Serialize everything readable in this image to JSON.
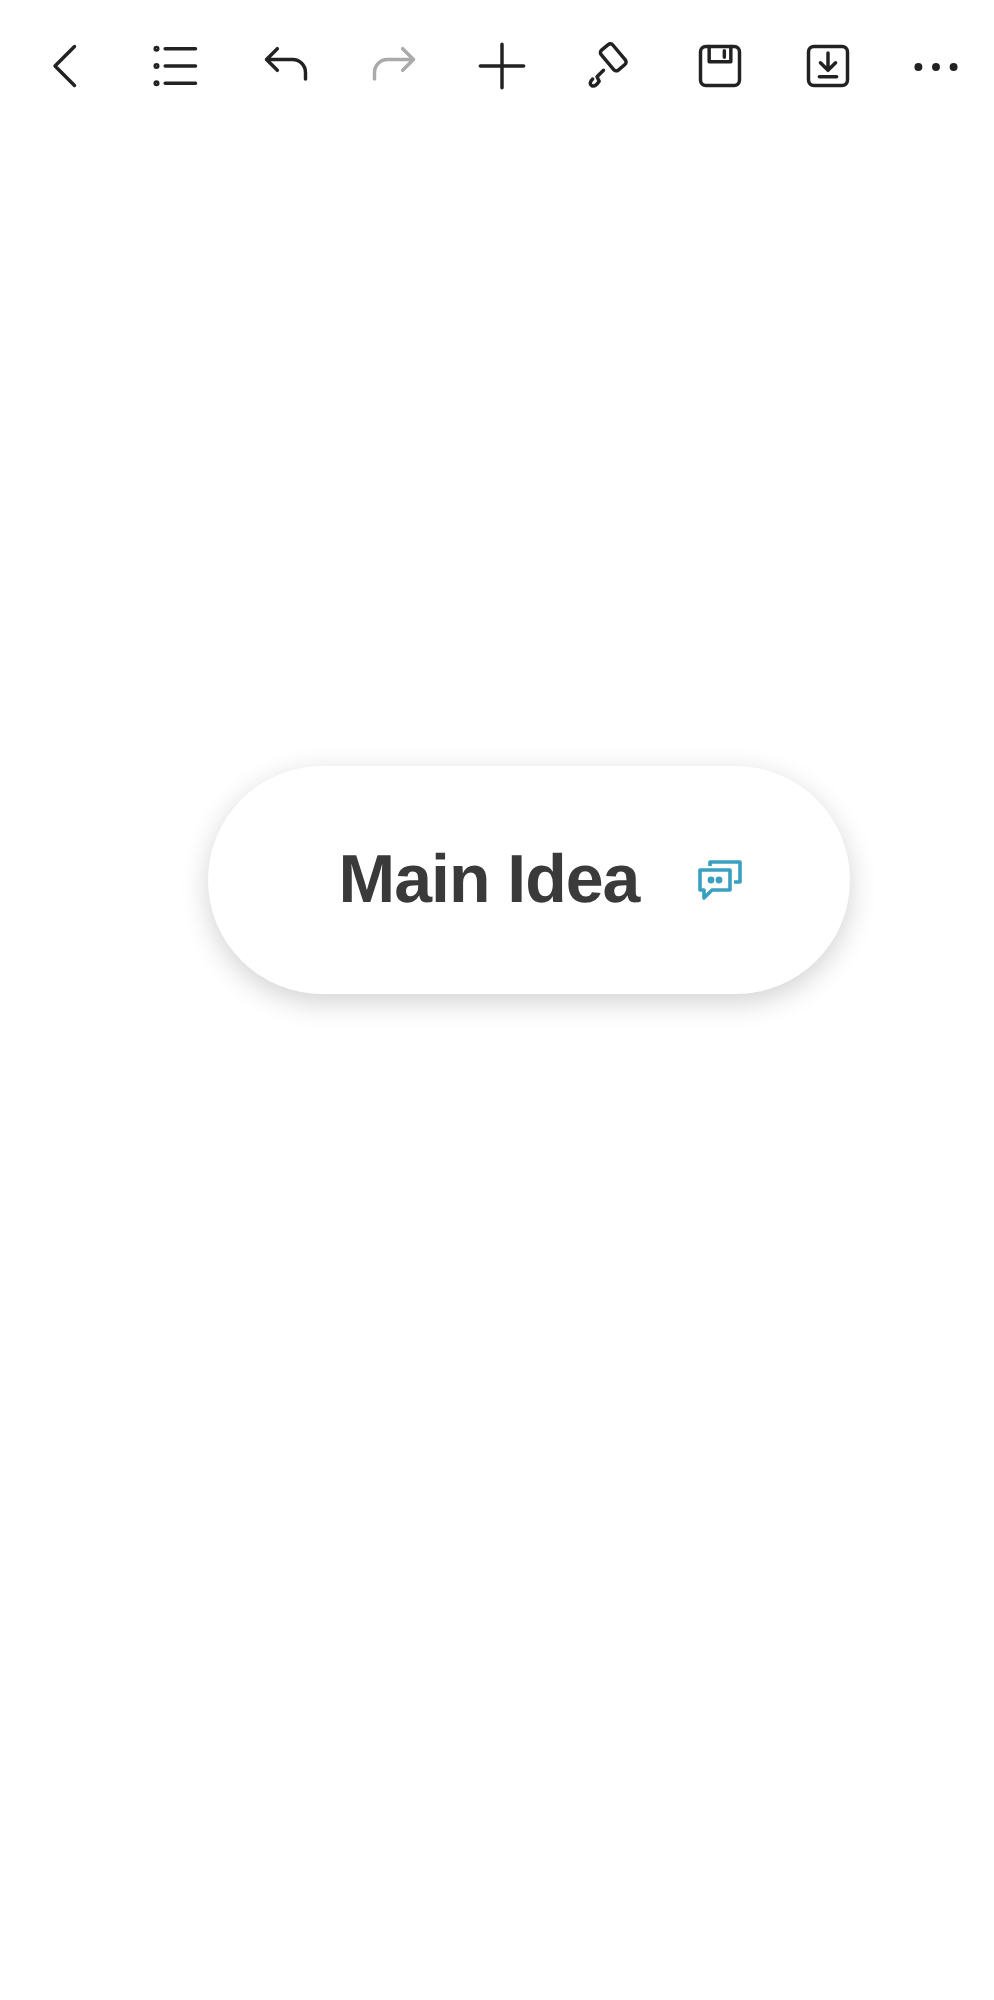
{
  "toolbar": [
    {
      "kind": "back",
      "disabled": false
    },
    {
      "kind": "outline",
      "disabled": false
    },
    {
      "kind": "undo",
      "disabled": false
    },
    {
      "kind": "redo",
      "disabled": true
    },
    {
      "kind": "add",
      "disabled": false
    },
    {
      "kind": "format",
      "disabled": false
    },
    {
      "kind": "save",
      "disabled": false
    },
    {
      "kind": "export",
      "disabled": false
    },
    {
      "kind": "more",
      "disabled": false
    }
  ],
  "canvas": {
    "central_topic": {
      "title": "Main Idea",
      "has_comment": true
    }
  }
}
